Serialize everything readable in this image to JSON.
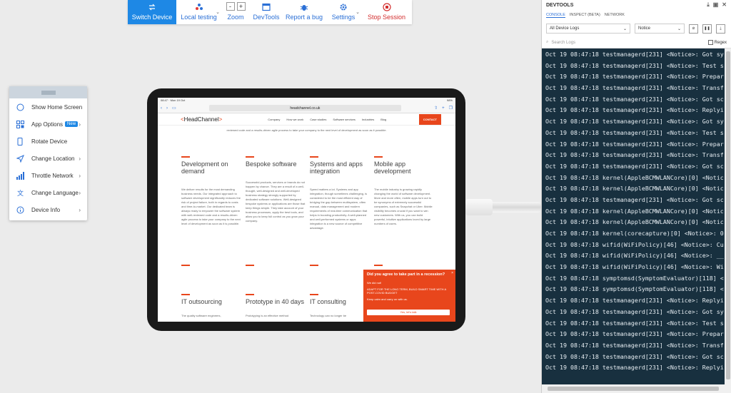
{
  "toolbar": {
    "switch_device": "Switch Device",
    "local_testing": "Local testing",
    "zoom": "Zoom",
    "devtools": "DevTools",
    "report_bug": "Report a bug",
    "settings": "Settings",
    "stop_session": "Stop Session",
    "zoom_minus": "-",
    "zoom_plus": "+"
  },
  "device_menu": {
    "items": [
      {
        "label": "Show Home Screen",
        "icon": "home-circle-icon"
      },
      {
        "label": "App Options",
        "badge": "New",
        "icon": "apps-icon"
      },
      {
        "label": "Rotate Device",
        "icon": "rotate-icon"
      },
      {
        "label": "Change Location",
        "icon": "location-arrow-icon"
      },
      {
        "label": "Throttle Network",
        "icon": "signal-bars-icon"
      },
      {
        "label": "Change Language",
        "icon": "translate-icon"
      },
      {
        "label": "Device Info",
        "icon": "info-icon"
      }
    ]
  },
  "browser": {
    "status_time": "08:47 · Mon 19 Oct",
    "status_battery": "98%",
    "url_prefix": "aA",
    "url": "headchannel.co.uk",
    "logo_open": "<",
    "logo_text": "HeadChannel",
    "logo_close": ">",
    "nav": [
      "Company",
      "How we work",
      "Case studies",
      "Software services",
      "Industries",
      "Blog"
    ],
    "contact": "CONTACT",
    "tagline": "reviewed code and a results-driven agile process to take your company to the next level of development as soon as it possible.",
    "cards": [
      {
        "title": "Development on demand",
        "desc": "We deliver results for the most demanding business needs. Our integrated approach to software development significantly reduces the risk of project failure, both in regards to costs and time-to-market. Our dedicated team is always ready to empower the software system with well-reviewed code and a results-driven agile process to take your company to the next level of development as soon as it is possible."
      },
      {
        "title": "Bespoke software",
        "desc": "Successful products, services or brands do not happen by chance. They are a result of a well-thought, well-designed and well-developed business strategy strongly supported by dedicated software solutions. Well-designed bespoke systems or applications are those that keep things simple. They take account of your business processes, apply the best tools, and allow you to keep full control as you grow your company."
      },
      {
        "title": "Systems and apps integration",
        "desc": "Speed matters a lot. Systems and app integration, though sometimes challenging, is considered to be the most efficient way of bridging the gap between multisystem, often manual, data management and modern requirements of real-time communication that helps in boosting productivity. A well-planned and well-performed systems or apps integration is a new source of competitive advantage."
      },
      {
        "title": "Mobile app development",
        "desc": "The mobile industry is growing rapidly changing the world of software development. More and more often, mobile apps turn out to be synonyms of extremely successful companies, such as Snapchat or Uber. Mobile visibility becomes crucial if you want to win new customers. With us, you can build powerful, intuitive applications loved by large numbers of users."
      }
    ],
    "cards2": [
      {
        "title": "IT outsourcing",
        "desc": "The quality software engineers,"
      },
      {
        "title": "Prototype in 40 days",
        "desc": "Prototyping is an effective method"
      },
      {
        "title": "IT consulting",
        "desc": "Technology can no longer be"
      }
    ],
    "popup": {
      "title": "Did you agree to take part in a recession?",
      "line1": "We did not!",
      "line2": "ADAPT FOR THE LONG TERM, BUILD SMART TIME WITH A POST-COVID BUDGET",
      "line3": "Keep calm and carry on with us.",
      "button": "Yes, let's talk",
      "close": "×"
    }
  },
  "devtools": {
    "title": "DEVTOOLS",
    "tabs": [
      "CONSOLE",
      "INSPECT (BETA)",
      "NETWORK"
    ],
    "log_source": "All Device Logs",
    "log_level": "Notice",
    "search_placeholder": "Search Logs",
    "regex": "Regex",
    "logs": [
      "Oct 19 08:47:18 testmanagerd[231] <Notice>: Got sy",
      "Oct 19 08:47:18 testmanagerd[231] <Notice>: Test s",
      "Oct 19 08:47:18 testmanagerd[231] <Notice>: Prepar",
      "Oct 19 08:47:18 testmanagerd[231] <Notice>: Transf",
      "Oct 19 08:47:18 testmanagerd[231] <Notice>: Got sc",
      "Oct 19 08:47:18 testmanagerd[231] <Notice>: Replyi",
      "Oct 19 08:47:18 testmanagerd[231] <Notice>: Got sy",
      "Oct 19 08:47:18 testmanagerd[231] <Notice>: Test s",
      "Oct 19 08:47:18 testmanagerd[231] <Notice>: Prepar",
      "Oct 19 08:47:18 testmanagerd[231] <Notice>: Transf",
      "Oct 19 08:47:18 testmanagerd[231] <Notice>: Got sc",
      "Oct 19 08:47:18 kernel(AppleBCMWLANCore)[0] <Notic",
      "Oct 19 08:47:18 kernel(AppleBCMWLANCore)[0] <Notic",
      "Oct 19 08:47:18 testmanagerd[231] <Notice>: Got sc",
      "Oct 19 08:47:18 kernel(AppleBCMWLANCore)[0] <Notic",
      "Oct 19 08:47:18 kernel(AppleBCMWLANCore)[0] <Notic",
      "Oct 19 08:47:18 kernel(corecapture)[0] <Notice>: 0",
      "Oct 19 08:47:18 wifid(WiFiPolicy)[46] <Notice>: Cu",
      "Oct 19 08:47:18 wifid(WiFiPolicy)[46] <Notice>: __",
      "Oct 19 08:47:18 wifid(WiFiPolicy)[46] <Notice>: Wi",
      "Oct 19 08:47:18 symptomsd(SymptomEvaluator)[118] <",
      "Oct 19 08:47:18 symptomsd(SymptomEvaluator)[118] <",
      "Oct 19 08:47:18 testmanagerd[231] <Notice>: Replyi",
      "Oct 19 08:47:18 testmanagerd[231] <Notice>: Got sy",
      "Oct 19 08:47:18 testmanagerd[231] <Notice>: Test s",
      "Oct 19 08:47:18 testmanagerd[231] <Notice>: Prepar",
      "Oct 19 08:47:18 testmanagerd[231] <Notice>: Transf",
      "Oct 19 08:47:18 testmanagerd[231] <Notice>: Got sc",
      "Oct 19 08:47:18 testmanagerd[231] <Notice>: Replyi"
    ]
  }
}
